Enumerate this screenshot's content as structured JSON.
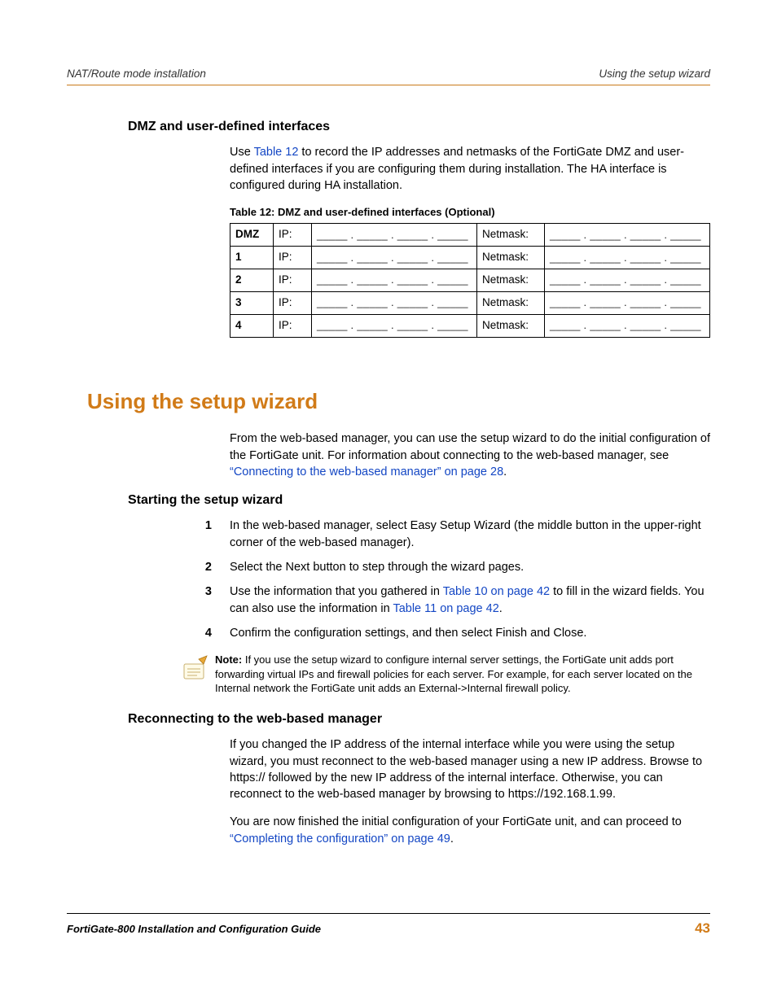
{
  "header": {
    "left": "NAT/Route mode installation",
    "right": "Using the setup wizard"
  },
  "section1": {
    "heading": "DMZ and user-defined interfaces",
    "para_pre": "Use ",
    "para_link": "Table 12",
    "para_post": " to record the IP addresses and netmasks of the FortiGate DMZ and user-defined interfaces if you are configuring them during installation. The HA interface is configured during HA installation."
  },
  "table": {
    "caption": "Table 12: DMZ and user-defined interfaces (Optional)",
    "rows": [
      "DMZ",
      "1",
      "2",
      "3",
      "4"
    ],
    "ip_label": "IP:",
    "netmask_label": "Netmask:",
    "blank_pattern": "_____ . _____ . _____ . _____"
  },
  "chapter": {
    "heading": "Using the setup wizard",
    "para_pre": "From the web-based manager, you can use the setup wizard to do the initial configuration of the FortiGate unit. For information about connecting to the web-based manager, see ",
    "para_link": "“Connecting to the web-based manager” on page 28",
    "para_post": "."
  },
  "section2": {
    "heading": "Starting the setup wizard",
    "steps": [
      {
        "num": "1",
        "text_plain": "In the web-based manager, select Easy Setup Wizard (the middle button in the upper-right corner of the web-based manager)."
      },
      {
        "num": "2",
        "text_plain": "Select the Next button to step through the wizard pages."
      },
      {
        "num": "3",
        "pre": "Use the information that you gathered in ",
        "link1": "Table 10 on page 42",
        "mid": " to fill in the wizard fields. You can also use the information in ",
        "link2": "Table 11 on page 42",
        "post": "."
      },
      {
        "num": "4",
        "text_plain": "Confirm the configuration settings, and then select Finish and Close."
      }
    ],
    "note_label": "Note:",
    "note_body": " If you use the setup wizard to configure internal server settings, the FortiGate unit adds port forwarding virtual IPs and firewall policies for each server. For example, for each server located on the Internal network the FortiGate unit adds an External->Internal firewall policy."
  },
  "section3": {
    "heading": "Reconnecting to the web-based manager",
    "para1": "If you changed the IP address of the internal interface while you were using the setup wizard, you must reconnect to the web-based manager using a new IP address. Browse to https:// followed by the new IP address of the internal interface. Otherwise, you can reconnect to the web-based manager by browsing to https://192.168.1.99.",
    "para2_pre": "You are now finished the initial configuration of your FortiGate unit, and can proceed to ",
    "para2_link": "“Completing the configuration” on page 49",
    "para2_post": "."
  },
  "footer": {
    "title": "FortiGate-800 Installation and Configuration Guide",
    "page": "43"
  }
}
